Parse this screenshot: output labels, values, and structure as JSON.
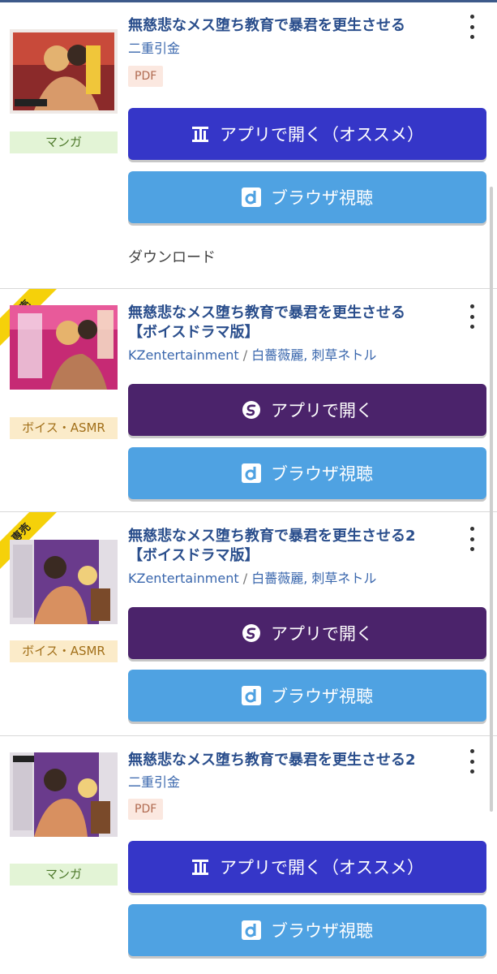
{
  "items": [
    {
      "title": "無慈悲なメス堕ち教育で暴君を更生させる",
      "author": "二重引金",
      "format": "PDF",
      "genre": "マンガ",
      "app_button": "アプリで開く（オススメ）",
      "browser_button": "ブラウザ視聴",
      "download_link": "ダウンロード"
    },
    {
      "badge": "専売",
      "title_line1": "無慈悲なメス堕ち教育で暴君を更生させる",
      "title_line2": "【ボイスドラマ版】",
      "circle": "KZentertainment",
      "separator": "/",
      "voice_actors": "白薔薇麗, 刺草ネトル",
      "genre": "ボイス・ASMR",
      "app_button": "アプリで開く",
      "browser_button": "ブラウザ視聴"
    },
    {
      "badge": "専売",
      "title_line1": "無慈悲なメス堕ち教育で暴君を更生させる2",
      "title_line2": "【ボイスドラマ版】",
      "circle": "KZentertainment",
      "separator": "/",
      "voice_actors": "白薔薇麗, 刺草ネトル",
      "genre": "ボイス・ASMR",
      "app_button": "アプリで開く",
      "browser_button": "ブラウザ視聴"
    },
    {
      "title": "無慈悲なメス堕ち教育で暴君を更生させる2",
      "author": "二重引金",
      "format": "PDF",
      "genre": "マンガ",
      "app_button": "アプリで開く（オススメ）",
      "browser_button": "ブラウザ視聴"
    }
  ],
  "icons": {
    "app_blue": "comic-app-icon",
    "app_purple": "voice-app-icon",
    "browser": "browser-d-icon",
    "menu": "kebab-menu-icon"
  },
  "colors": {
    "title": "#2a4e8c",
    "app_button_manga": "#3536c8",
    "app_button_voice": "#4b236b",
    "browser_button": "#4fa2e2",
    "badge": "#f5d10a"
  }
}
